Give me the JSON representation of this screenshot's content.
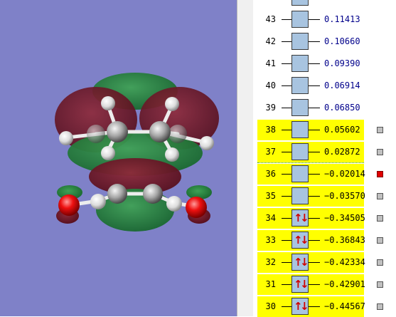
{
  "viewer": {
    "background": "#7f81c8"
  },
  "orbitals": [
    {
      "index": "",
      "energy": "",
      "occupied": false
    },
    {
      "index": "43",
      "energy": "0.11413",
      "occupied": false
    },
    {
      "index": "42",
      "energy": "0.10660",
      "occupied": false
    },
    {
      "index": "41",
      "energy": "0.09390",
      "occupied": false
    },
    {
      "index": "40",
      "energy": "0.06914",
      "occupied": false
    },
    {
      "index": "39",
      "energy": "0.06850",
      "occupied": false
    },
    {
      "index": "38",
      "energy": "0.05602",
      "occupied": false,
      "highlight": true
    },
    {
      "index": "37",
      "energy": "0.02872",
      "occupied": false,
      "highlight": true
    },
    {
      "index": "36",
      "energy": "−0.02014",
      "occupied": false,
      "highlight": true,
      "selected": true
    },
    {
      "index": "35",
      "energy": "−0.03570",
      "occupied": false,
      "highlight": true
    },
    {
      "index": "34",
      "energy": "−0.34505",
      "occupied": true,
      "highlight": true
    },
    {
      "index": "33",
      "energy": "−0.36843",
      "occupied": true,
      "highlight": true
    },
    {
      "index": "32",
      "energy": "−0.42334",
      "occupied": true,
      "highlight": true
    },
    {
      "index": "31",
      "energy": "−0.42901",
      "occupied": true,
      "highlight": true
    },
    {
      "index": "30",
      "energy": "−0.44567",
      "occupied": true,
      "highlight": true
    }
  ],
  "colors": {
    "highlight": "#ffff00",
    "virtual_energy": "#00008b",
    "lobe_positive": "#1f7a3a",
    "lobe_negative": "#6b1020",
    "oxygen": "#ff0000",
    "carbon": "#a8a8a8",
    "hydrogen": "#ffffff",
    "marker_selected": "#e00000"
  },
  "icons": {
    "occupied": "spin-pair-icon",
    "selection": "marker-icon"
  }
}
